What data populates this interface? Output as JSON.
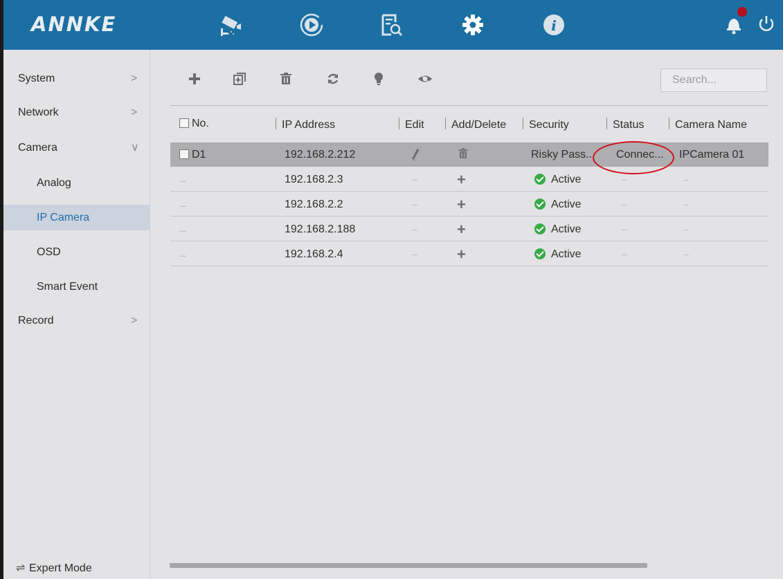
{
  "header": {
    "logo": "ANNKE",
    "nav_icons": [
      "camera-icon",
      "playback-icon",
      "search-file-icon",
      "settings-gear-icon",
      "info-icon"
    ],
    "right_icons": [
      "notification-bell-icon",
      "power-icon"
    ],
    "accent_color": "#1b6fa3",
    "alert_color": "#b3101b"
  },
  "sidebar": {
    "items": [
      {
        "label": "System",
        "chevron": ">"
      },
      {
        "label": "Network",
        "chevron": ">"
      },
      {
        "label": "Camera",
        "chevron": "∨"
      },
      {
        "label": "Analog"
      },
      {
        "label": "IP Camera",
        "selected": true
      },
      {
        "label": "OSD"
      },
      {
        "label": "Smart Event"
      },
      {
        "label": "Record",
        "chevron": ">"
      }
    ],
    "expert_mode": "Expert Mode"
  },
  "toolbar": {
    "tools": [
      "add-icon",
      "add-batch-icon",
      "delete-icon",
      "refresh-icon",
      "lightbulb-icon",
      "eye-icon"
    ],
    "search_placeholder": "Search..."
  },
  "table": {
    "columns": [
      "No.",
      "IP Address",
      "Edit",
      "Add/Delete",
      "Security",
      "Status",
      "Camera Name"
    ],
    "rows": [
      {
        "no": "D1",
        "ip": "192.168.2.212",
        "edit": "pencil",
        "add_delete": "trash",
        "security": "Risky Pass...",
        "status": "Connec...",
        "name": "IPCamera 01",
        "selected": true
      },
      {
        "no": "...",
        "ip": "192.168.2.3",
        "edit": "–",
        "add_delete": "+",
        "security": "Active",
        "status": "–",
        "name": "–"
      },
      {
        "no": "...",
        "ip": "192.168.2.2",
        "edit": "–",
        "add_delete": "+",
        "security": "Active",
        "status": "–",
        "name": "–"
      },
      {
        "no": "...",
        "ip": "192.168.2.188",
        "edit": "–",
        "add_delete": "+",
        "security": "Active",
        "status": "–",
        "name": "–"
      },
      {
        "no": "...",
        "ip": "192.168.2.4",
        "edit": "–",
        "add_delete": "+",
        "security": "Active",
        "status": "–",
        "name": "–"
      }
    ]
  },
  "status_colors": {
    "active": "#3aa94a",
    "highlight_ring": "#d0101a"
  }
}
